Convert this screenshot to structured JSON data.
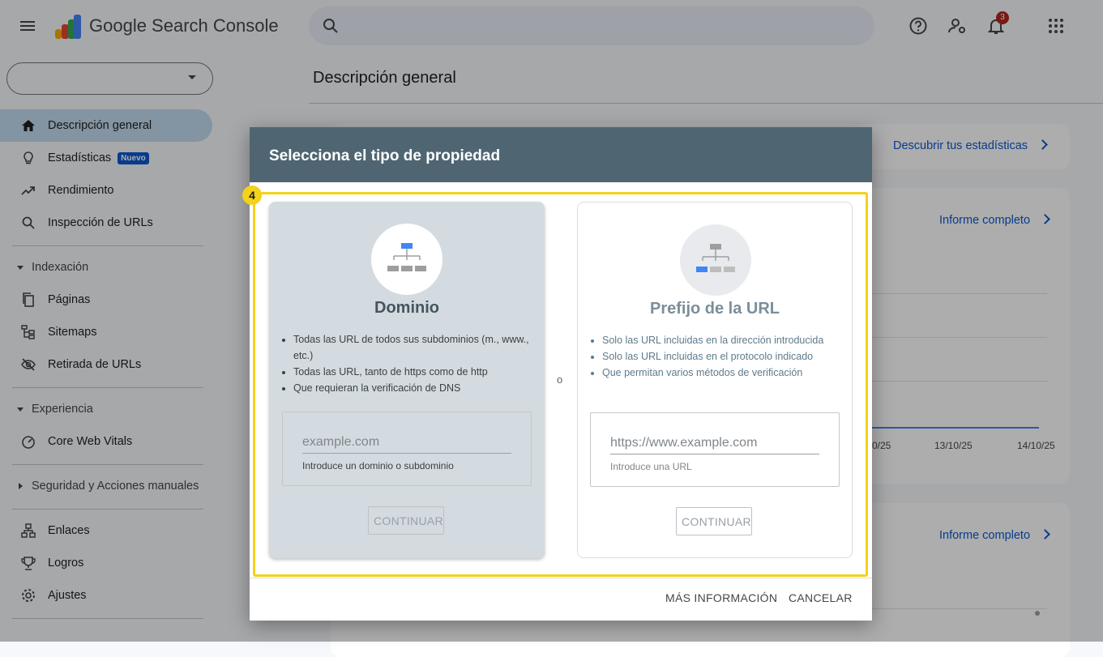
{
  "app": {
    "product_name": "Google Search Console"
  },
  "header": {
    "notification_count": "3"
  },
  "sidebar": {
    "items": [
      {
        "label": "Descripción general"
      },
      {
        "label": "Estadísticas",
        "badge": "Nuevo"
      },
      {
        "label": "Rendimiento"
      },
      {
        "label": "Inspección de URLs"
      }
    ],
    "indexacion": {
      "title": "Indexación",
      "items": [
        "Páginas",
        "Sitemaps",
        "Retirada de URLs"
      ]
    },
    "experiencia": {
      "title": "Experiencia",
      "items": [
        "Core Web Vitals"
      ]
    },
    "seguridad": {
      "title": "Seguridad y Acciones manuales"
    },
    "bottom": [
      "Enlaces",
      "Logros",
      "Ajustes"
    ]
  },
  "main": {
    "title": "Descripción general",
    "card1_link": "Descubrir tus estadísticas",
    "card2_link": "Informe completo",
    "card3_link": "Informe completo",
    "chart_ticks": [
      "0/25",
      "13/10/25",
      "14/10/25"
    ]
  },
  "dialog": {
    "title": "Selecciona el tipo de propiedad",
    "step_badge": "4",
    "or_label": "o",
    "domain": {
      "title": "Dominio",
      "bullets": [
        "Todas las URL de todos sus subdominios (m., www., etc.)",
        "Todas las URL, tanto de https como de http",
        "Que requieran la verificación de DNS"
      ],
      "placeholder": "example.com",
      "hint": "Introduce un dominio o subdominio",
      "button": "CONTINUAR"
    },
    "url_prefix": {
      "title": "Prefijo de la URL",
      "bullets": [
        "Solo las URL incluidas en la dirección introducida",
        "Solo las URL incluidas en el protocolo indicado",
        "Que permitan varios métodos de verificación"
      ],
      "placeholder": "https://www.example.com",
      "hint": "Introduce una URL",
      "button": "CONTINUAR"
    },
    "more_info": "MÁS INFORMACIÓN",
    "cancel": "CANCELAR"
  },
  "colors": {
    "accent": "#0b57d0",
    "dialog_header": "#4f6672",
    "highlight": "#f3d21c",
    "domain_title": "#44555e",
    "url_title": "#7b8e99",
    "url_text": "#5f7a8c"
  }
}
